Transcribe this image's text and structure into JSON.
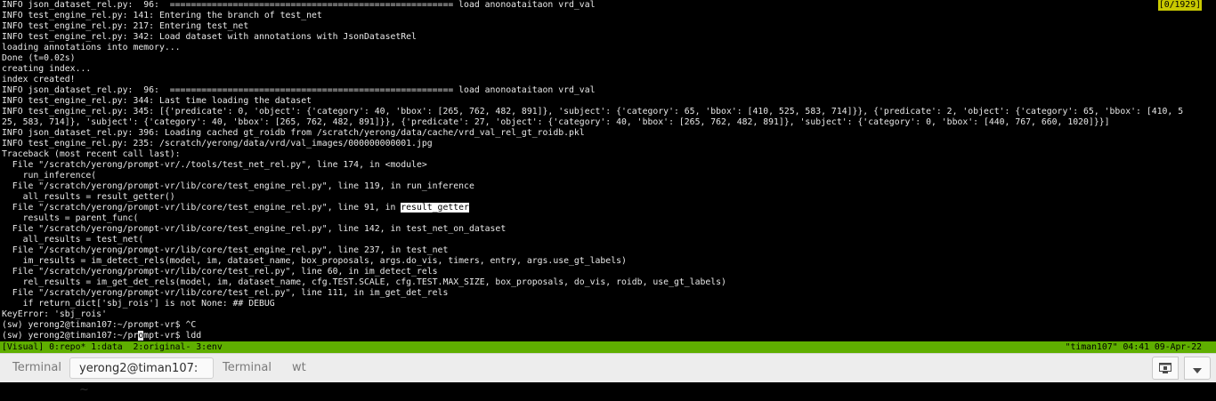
{
  "terminal": {
    "lines": [
      [
        {
          "t": "INFO json_dataset_rel.py:  96:  ====================================================== load anonoataitaon vrd_val"
        }
      ],
      [
        {
          "t": "INFO test_engine_rel.py: 141: Entering the branch of test_net"
        }
      ],
      [
        {
          "t": "INFO test_engine_rel.py: 217: Entering test_net"
        }
      ],
      [
        {
          "t": "INFO test_engine_rel.py: 342: Load dataset with annotations with JsonDatasetRel"
        }
      ],
      [
        {
          "t": "loading annotations into memory..."
        }
      ],
      [
        {
          "t": "Done (t=0.02s)"
        }
      ],
      [
        {
          "t": "creating index..."
        }
      ],
      [
        {
          "t": "index created!"
        }
      ],
      [
        {
          "t": "INFO json_dataset_rel.py:  96:  ====================================================== load anonoataitaon vrd_val"
        }
      ],
      [
        {
          "t": "INFO test_engine_rel.py: 344: Last time loading the dataset"
        }
      ],
      [
        {
          "t": "INFO test_engine_rel.py: 345: [{'predicate': 0, 'object': {'category': 40, 'bbox': [265, 762, 482, 891]}, 'subject': {'category': 65, 'bbox': [410, 525, 583, 714]}}, {'predicate': 2, 'object': {'category': 65, 'bbox': [410, 5"
        }
      ],
      [
        {
          "t": "25, 583, 714]}, 'subject': {'category': 40, 'bbox': [265, 762, 482, 891]}}, {'predicate': 27, 'object': {'category': 40, 'bbox': [265, 762, 482, 891]}, 'subject': {'category': 0, 'bbox': [440, 767, 660, 1020]}}]"
        }
      ],
      [
        {
          "t": "INFO json_dataset_rel.py: 396: Loading cached gt_roidb from /scratch/yerong/data/cache/vrd_val_rel_gt_roidb.pkl"
        }
      ],
      [
        {
          "t": "INFO test_engine_rel.py: 235: /scratch/yerong/data/vrd/val_images/000000000001.jpg"
        }
      ],
      [
        {
          "t": "Traceback (most recent call last):"
        }
      ],
      [
        {
          "t": "  File \"/scratch/yerong/prompt-vr/./tools/test_net_rel.py\", line 174, in <module>"
        }
      ],
      [
        {
          "t": "    run_inference("
        }
      ],
      [
        {
          "t": "  File \"/scratch/yerong/prompt-vr/lib/core/test_engine_rel.py\", line 119, in run_inference"
        }
      ],
      [
        {
          "t": "    all_results = result_getter()"
        }
      ],
      [
        {
          "t": "  File \"/scratch/yerong/prompt-vr/lib/core/test_engine_rel.py\", line 91, in "
        },
        {
          "t": "result_getter",
          "c": "hl"
        }
      ],
      [
        {
          "t": "    results = parent_func("
        }
      ],
      [
        {
          "t": "  File \"/scratch/yerong/prompt-vr/lib/core/test_engine_rel.py\", line 142, in test_net_on_dataset"
        }
      ],
      [
        {
          "t": "    all_results = test_net("
        }
      ],
      [
        {
          "t": "  File \"/scratch/yerong/prompt-vr/lib/core/test_engine_rel.py\", line 237, in test_net"
        }
      ],
      [
        {
          "t": "    im_results = im_detect_rels(model, im, dataset_name, box_proposals, args.do_vis, timers, entry, args.use_gt_labels)"
        }
      ],
      [
        {
          "t": "  File \"/scratch/yerong/prompt-vr/lib/core/test_rel.py\", line 60, in im_detect_rels"
        }
      ],
      [
        {
          "t": "    rel_results = im_get_det_rels(model, im, dataset_name, cfg.TEST.SCALE, cfg.TEST.MAX_SIZE, box_proposals, do_vis, roidb, use_gt_labels)"
        }
      ],
      [
        {
          "t": "  File \"/scratch/yerong/prompt-vr/lib/core/test_rel.py\", line 111, in im_get_det_rels"
        }
      ],
      [
        {
          "t": "    if return_dict['sbj_rois'] is not None: ## DEBUG"
        }
      ],
      [
        {
          "t": "KeyError: 'sbj_rois'"
        }
      ],
      [
        {
          "t": "(sw) yerong2@timan107:~/prompt-vr$ ^C"
        }
      ],
      [
        {
          "t": "(sw) yerong2@timan107:~/pr"
        },
        {
          "t": "o",
          "c": "cursor"
        },
        {
          "t": "mpt-vr$ ldd"
        }
      ]
    ],
    "search_counter": "[0/1929]"
  },
  "status_bar": {
    "left": "[Visual] 0:repo* 1:data  2:original- 3:env",
    "right": "\"timan107\" 04:41 09-Apr-22"
  },
  "tabs": [
    {
      "label": "Terminal",
      "active": false
    },
    {
      "label": "yerong2@timan107: ~",
      "active": true
    },
    {
      "label": "Terminal",
      "active": false
    },
    {
      "label": "wt",
      "active": false
    }
  ],
  "icons": {
    "new_tab": "new-tab-icon",
    "menu": "chevron-down-icon"
  },
  "colors": {
    "terminal_bg": "#000000",
    "terminal_fg": "#e8e8e8",
    "status_bar_bg": "#5faf00",
    "search_counter_bg": "#c8c800",
    "tab_bar_bg": "#ededed"
  }
}
